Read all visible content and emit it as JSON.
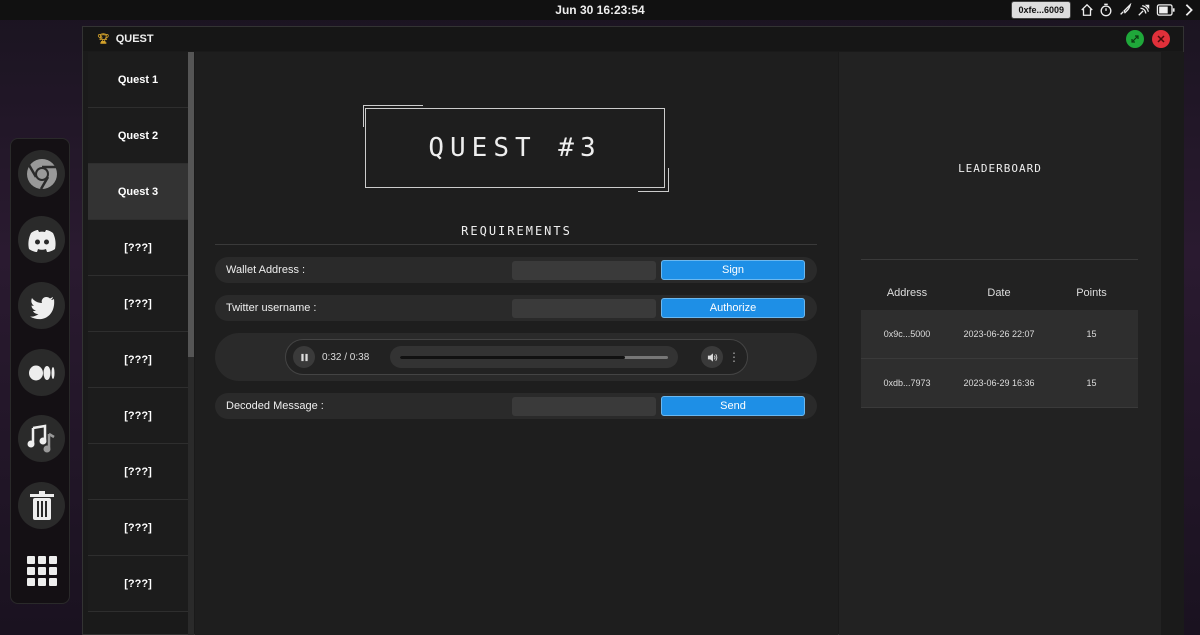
{
  "topbar": {
    "clock": "Jun 30 16:23:54",
    "wallet": "0xfe...6009",
    "icons": [
      "home-icon",
      "timer-icon",
      "rocket-icon",
      "broadcast-icon",
      "battery-icon",
      "chevron-right-icon"
    ]
  },
  "dock": {
    "items": [
      "chrome-icon",
      "discord-icon",
      "twitter-icon",
      "medium-icon",
      "music-icon",
      "trash-icon",
      "apps-grid-icon"
    ]
  },
  "window": {
    "title": "QUEST",
    "trophy_icon": "trophy-icon",
    "accent_colors": {
      "maximize": "#1fa83a",
      "close": "#e0303a",
      "primary_button": "#1e8fe6"
    }
  },
  "quests": [
    {
      "label": "Quest 1",
      "active": false
    },
    {
      "label": "Quest 2",
      "active": false
    },
    {
      "label": "Quest 3",
      "active": true
    },
    {
      "label": "[???]",
      "active": false
    },
    {
      "label": "[???]",
      "active": false
    },
    {
      "label": "[???]",
      "active": false
    },
    {
      "label": "[???]",
      "active": false
    },
    {
      "label": "[???]",
      "active": false
    },
    {
      "label": "[???]",
      "active": false
    },
    {
      "label": "[???]",
      "active": false
    }
  ],
  "main": {
    "quest_title": "QUEST #3",
    "requirements_title": "REQUIREMENTS",
    "wallet_label": "Wallet Address :",
    "wallet_value": "",
    "sign_label": "Sign",
    "twitter_label": "Twitter username :",
    "twitter_value": "",
    "authorize_label": "Authorize",
    "audio_time": "0:32 / 0:38",
    "audio_progress": 0.84,
    "decoded_label": "Decoded Message :",
    "decoded_value": "",
    "send_label": "Send"
  },
  "leaderboard": {
    "title": "LEADERBOARD",
    "columns": [
      "Address",
      "Date",
      "Points"
    ],
    "rows": [
      [
        "0x9c...5000",
        "2023-06-26 22:07",
        "15"
      ],
      [
        "0xdb...7973",
        "2023-06-29 16:36",
        "15"
      ]
    ]
  }
}
